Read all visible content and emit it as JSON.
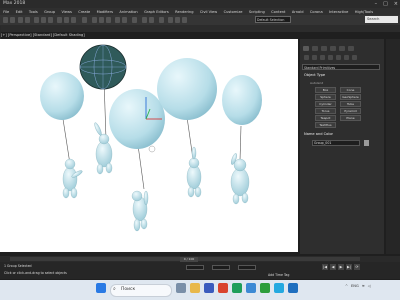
{
  "app": {
    "title": "Max 2018"
  },
  "menu": {
    "items": [
      "File",
      "Edit",
      "Tools",
      "Group",
      "Views",
      "Create",
      "Modifiers",
      "Animation",
      "Graph Editors",
      "Rendering",
      "Civil View",
      "Customize",
      "Scripting",
      "Content",
      "Arnold",
      "Corona",
      "Interactive",
      "High/Tools"
    ]
  },
  "toolbar": {
    "workspace_value": "Default Selection Set",
    "search_value": "Search"
  },
  "viewport": {
    "label": "[+] [Perspective] [Standard] [Default Shading]"
  },
  "command_panel": {
    "category_value": "Standard Primitives",
    "object_type_header": "Object Type",
    "autogrid_label": "AutoGrid",
    "object_buttons": [
      "Box",
      "Cone",
      "Sphere",
      "GeoSphere",
      "Cylinder",
      "Tube",
      "Torus",
      "Pyramid",
      "Teapot",
      "Plane",
      "TextPlus"
    ],
    "name_color_header": "Name and Color",
    "name_value": "Group_001",
    "swatch_color": "#9a9a9a"
  },
  "timeline": {
    "frame_value": "0 / 100"
  },
  "status": {
    "selection_text": "1 Group Selected",
    "hint_text": "Click or click-and-drag to select objects",
    "add_time_tag": "Add Time Tag"
  },
  "playback": {
    "buttons": [
      "|◀",
      "◀",
      "▶",
      "▶|",
      "⟳"
    ]
  },
  "taskbar": {
    "search_text": "Поиск",
    "language": "ENG"
  },
  "colors": {
    "balloon": "#c8e9f2",
    "viewport_bg": "#ffffff"
  }
}
